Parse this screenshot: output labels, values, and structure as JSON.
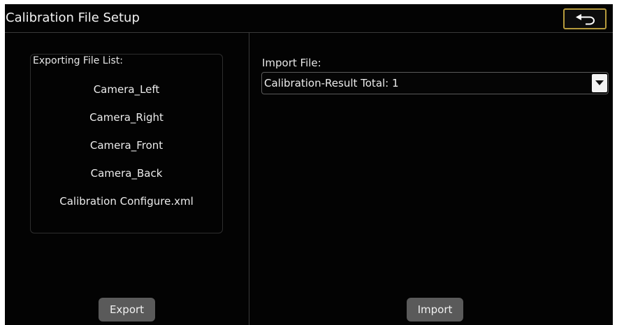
{
  "window": {
    "title": "Calibration File Setup",
    "back_icon": "back-arrow-icon"
  },
  "export_panel": {
    "list_label": "Exporting File List:",
    "files": [
      "Camera_Left",
      "Camera_Right",
      "Camera_Front",
      "Camera_Back",
      "Calibration Configure.xml"
    ],
    "export_label": "Export"
  },
  "import_panel": {
    "label": "Import File:",
    "selected_file": "Calibration-Result Total: 1",
    "import_label": "Import"
  },
  "colors": {
    "background": "#030303",
    "accent_border": "#b59a3c",
    "button": "#5a5a5a"
  }
}
